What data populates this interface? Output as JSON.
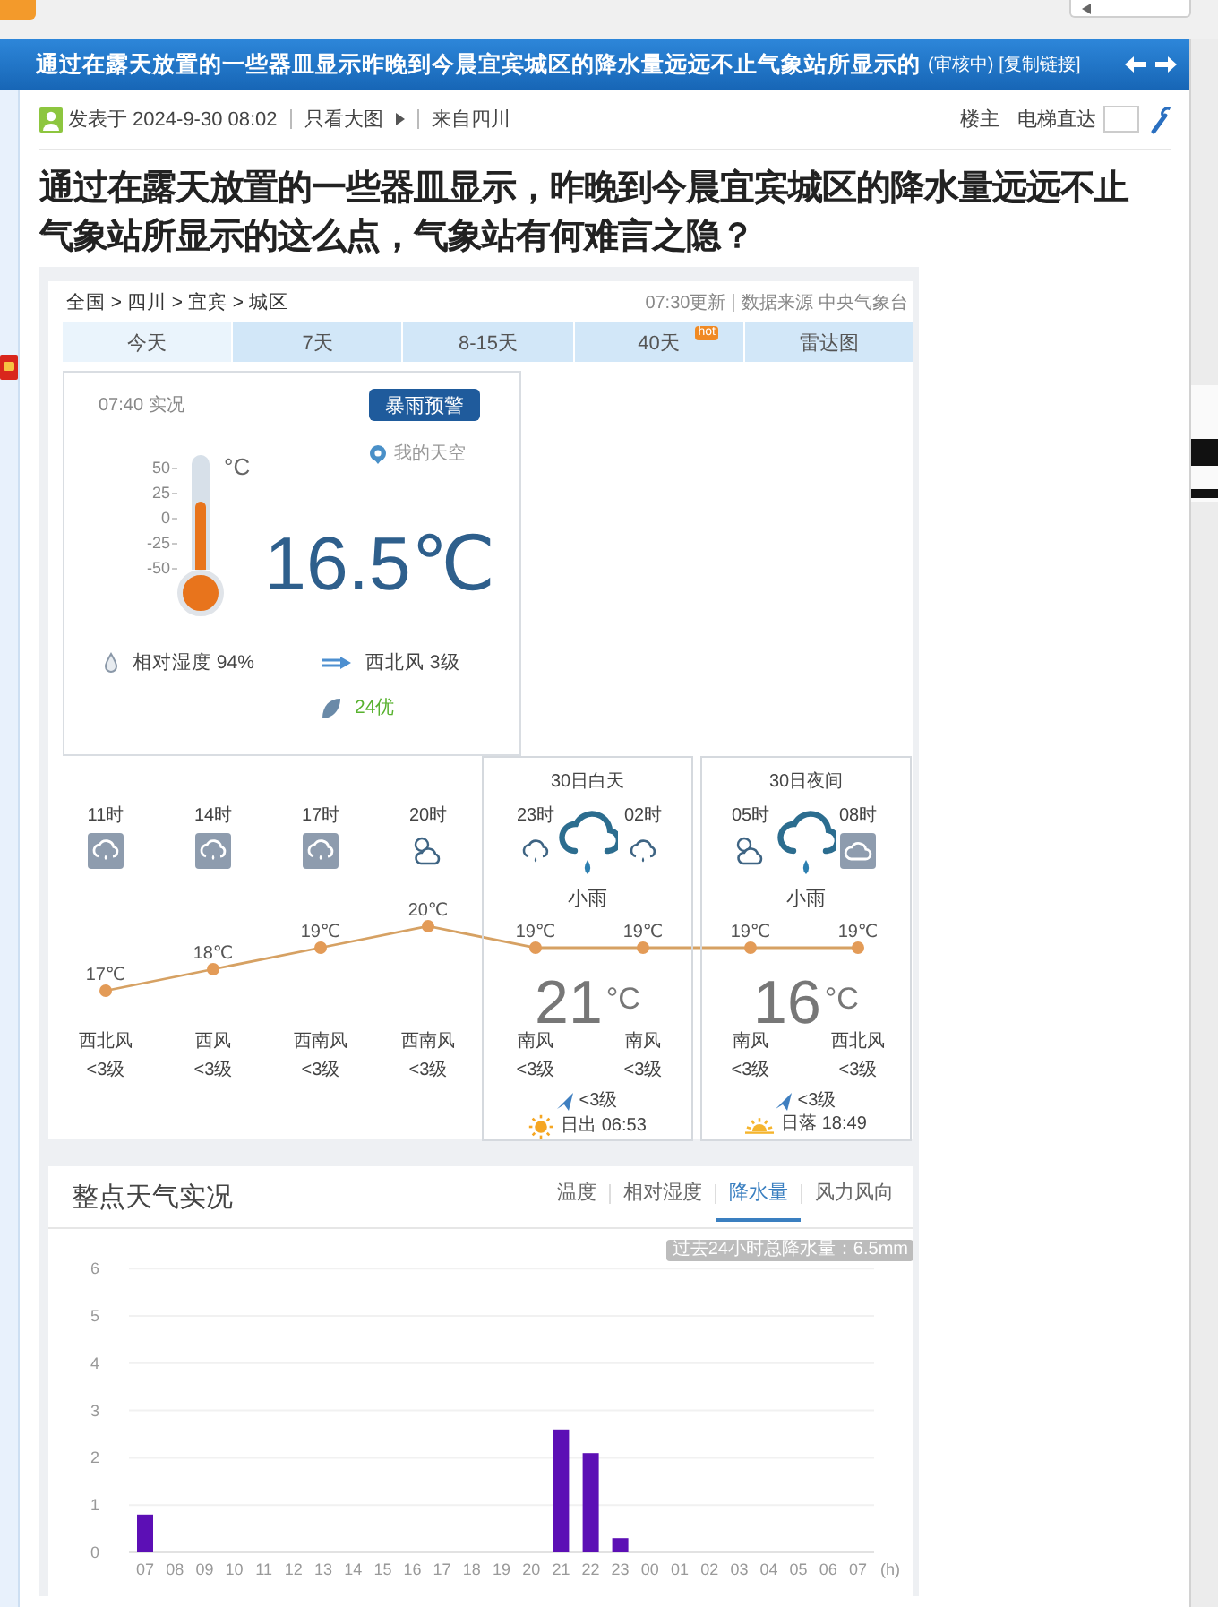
{
  "thread_header": {
    "title": "通过在露天放置的一些器皿显示昨晚到今晨宜宾城区的降水量远远不止气象站所显示的",
    "status": "(审核中)",
    "copy_link": "[复制链接]"
  },
  "post_meta": {
    "posted": "发表于 2024-9-30 08:02",
    "view_images": "只看大图",
    "origin": "来自四川",
    "author_tag": "楼主",
    "jump_label": "电梯直达"
  },
  "headline": "通过在露天放置的一些器皿显示，昨晚到今晨宜宾城区的降水量远远不止气象站所显示的这么点，气象站有何难言之隐？",
  "weather": {
    "breadcrumb": "全国 > 四川 > 宜宾 > 城区",
    "updated": "07:30更新",
    "source": "数据来源 中央气象台",
    "tabs": [
      {
        "label": "今天",
        "selected": true
      },
      {
        "label": "7天",
        "selected": false
      },
      {
        "label": "8-15天",
        "selected": false
      },
      {
        "label": "40天",
        "selected": false,
        "badge": "hot"
      },
      {
        "label": "雷达图",
        "selected": false
      }
    ],
    "current": {
      "observed": "07:40 实况",
      "alert": "暴雨预警",
      "my_sky": "我的天空",
      "scale": [
        "50",
        "25",
        "0",
        "-25",
        "-50"
      ],
      "scale_unit": "°C",
      "thermometer": {
        "level": 0.6
      },
      "temperature": "16.5℃",
      "humidity": "相对湿度 94%",
      "wind": "西北风 3级",
      "aqi": "24优"
    },
    "hourly": {
      "chart_data": {
        "type": "line",
        "categories": [
          "11时",
          "14时",
          "17时",
          "20时",
          "23时",
          "02时",
          "05时",
          "08时"
        ],
        "values": [
          17,
          18,
          19,
          20,
          19,
          19,
          19,
          19
        ],
        "marker": true,
        "data_labels": true,
        "value_labels": [
          "17℃",
          "18℃",
          "19℃",
          "20℃",
          "19℃",
          "19℃",
          "19℃",
          "19℃"
        ]
      },
      "items": [
        {
          "kind": "rain",
          "wind": "西北风",
          "force": "<3级"
        },
        {
          "kind": "rain",
          "wind": "西风",
          "force": "<3级"
        },
        {
          "kind": "rain",
          "wind": "西南风",
          "force": "<3级"
        },
        {
          "kind": "partly",
          "wind": "西南风",
          "force": "<3级"
        },
        {
          "kind": "drizzle",
          "wind": "南风",
          "force": "<3级"
        },
        {
          "kind": "drizzle",
          "wind": "南风",
          "force": "<3级"
        },
        {
          "kind": "partly",
          "wind": "南风",
          "force": "<3级"
        },
        {
          "kind": "overcast",
          "wind": "西北风",
          "force": "<3级"
        }
      ]
    },
    "day_parts": [
      {
        "title": "30日白天",
        "condition": "小雨",
        "temperature": "21$^{°C}$",
        "wind": "<3级",
        "kind": "sunrise",
        "sun": "日出 06:53"
      },
      {
        "title": "30日夜间",
        "condition": "小雨",
        "temperature": "16$^{°C}$",
        "wind": "<3级",
        "kind": "sunset",
        "sun": "日落 18:49"
      }
    ],
    "observations": {
      "title": "整点天气实况",
      "tabs": [
        {
          "label": "温度",
          "selected": false
        },
        {
          "label": "相对湿度",
          "selected": false
        },
        {
          "label": "降水量",
          "selected": true
        },
        {
          "label": "风力风向",
          "selected": false
        }
      ],
      "total": "过去24小时总降水量：6.5mm",
      "chart_data": {
        "type": "bar",
        "categories": [
          "07",
          "08",
          "09",
          "10",
          "11",
          "12",
          "13",
          "14",
          "15",
          "16",
          "17",
          "18",
          "19",
          "20",
          "21",
          "22",
          "23",
          "00",
          "01",
          "02",
          "03",
          "04",
          "05",
          "06",
          "07"
        ],
        "values": [
          0.8,
          0,
          0,
          0,
          0,
          0,
          0,
          0,
          0,
          0,
          0,
          0,
          0,
          0,
          2.6,
          2.1,
          0.3,
          0,
          0,
          0,
          0,
          0,
          0,
          0,
          0
        ],
        "xlabel": "(h)",
        "ylim": [
          0,
          6
        ],
        "yticks": [
          0,
          1,
          2,
          3,
          4,
          5,
          6
        ],
        "grid": true
      }
    }
  }
}
